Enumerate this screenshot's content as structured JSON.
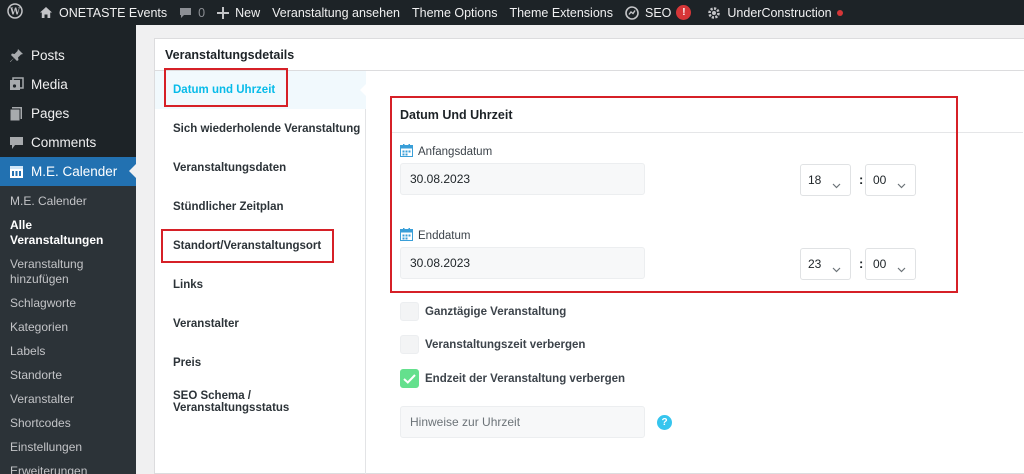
{
  "adminbar": {
    "site_name": "ONETASTE Events",
    "comments_count": "0",
    "new_label": "New",
    "view_event": "Veranstaltung ansehen",
    "theme_options": "Theme Options",
    "theme_extensions": "Theme Extensions",
    "seo_label": "SEO",
    "seo_badge": "!",
    "under_construction": "UnderConstruction"
  },
  "sidebar": {
    "menu": [
      {
        "label": "Posts",
        "icon": "pin-icon"
      },
      {
        "label": "Media",
        "icon": "media-icon"
      },
      {
        "label": "Pages",
        "icon": "pages-icon"
      },
      {
        "label": "Comments",
        "icon": "comments-icon"
      },
      {
        "label": "M.E. Calender",
        "icon": "calendar-icon"
      }
    ],
    "submenu": [
      "M.E. Calender",
      "Alle Veranstaltungen",
      "Veranstaltung hinzufügen",
      "Schlagworte",
      "Kategorien",
      "Labels",
      "Standorte",
      "Veranstalter",
      "Shortcodes",
      "Einstellungen",
      "Erweiterungen"
    ]
  },
  "panel": {
    "title": "Veranstaltungsdetails",
    "tabs": [
      "Datum und Uhrzeit",
      "Sich wiederholende Veranstaltung",
      "Veranstaltungsdaten",
      "Stündlicher Zeitplan",
      "Standort/Veranstaltungsort",
      "Links",
      "Veranstalter",
      "Preis",
      "SEO Schema / Veranstaltungsstatus"
    ],
    "section_title": "Datum Und Uhrzeit",
    "start": {
      "label": "Anfangsdatum",
      "date": "30.08.2023",
      "hour": "18",
      "minute": "00"
    },
    "end": {
      "label": "Enddatum",
      "date": "30.08.2023",
      "hour": "23",
      "minute": "00"
    },
    "colon": ":",
    "checks": [
      {
        "label": "Ganztägige Veranstaltung",
        "checked": false
      },
      {
        "label": "Veranstaltungszeit verbergen",
        "checked": false
      },
      {
        "label": "Endzeit der Veranstaltung verbergen",
        "checked": true
      }
    ],
    "hint_placeholder": "Hinweise zur Uhrzeit",
    "help_icon": "?"
  },
  "colors": {
    "admin_dark": "#1d2327",
    "active_blue": "#2271b1",
    "tab_accent": "#07bbe9",
    "highlight_red": "#d62027",
    "check_green": "#64e08d"
  }
}
